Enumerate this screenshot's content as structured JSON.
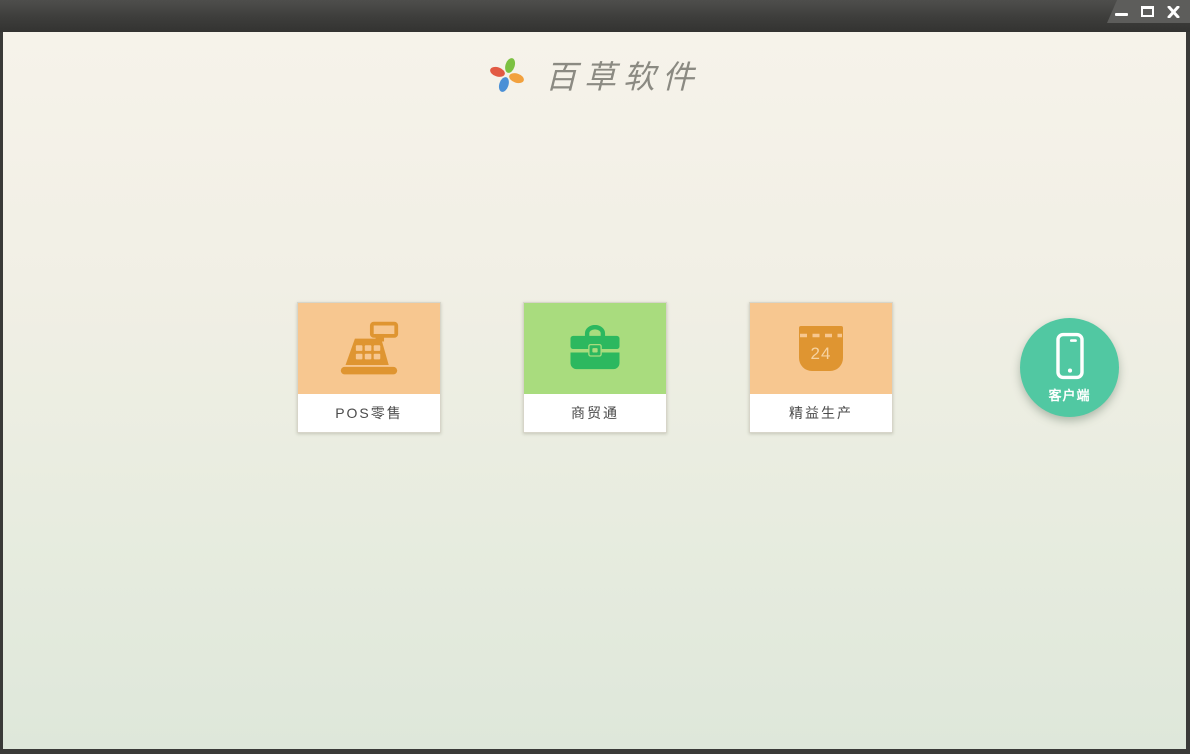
{
  "window": {
    "controls": [
      {
        "name": "minimize"
      },
      {
        "name": "maximize"
      },
      {
        "name": "close"
      }
    ]
  },
  "header": {
    "app_name": "百草软件",
    "logo": {
      "name": "pinwheel-logo",
      "petal_colors": {
        "top": "#7cc142",
        "right": "#f2a13e",
        "bottom": "#4b90d6",
        "left": "#e25a44"
      }
    }
  },
  "products": [
    {
      "label": "POS零售",
      "icon": "cash-register-icon",
      "tile_color": "#f7c790",
      "icon_color": "#df9531"
    },
    {
      "label": "商贸通",
      "icon": "briefcase-icon",
      "tile_color": "#a9dc7e",
      "icon_color": "#2cb85f"
    },
    {
      "label": "精益生产",
      "icon": "calendar-icon",
      "tile_color": "#f7c790",
      "icon_color": "#df9531",
      "calendar_day": "24"
    }
  ],
  "client_button": {
    "label": "客户端",
    "icon": "smartphone-icon",
    "color": "#51c8a2"
  },
  "theme": {
    "background_top": "#f5f2e9",
    "background_bottom": "#dee7da",
    "titlebar": "#3c3c3a",
    "card_label_text": "#4b4b4b",
    "header_text": "#8b8a82"
  }
}
